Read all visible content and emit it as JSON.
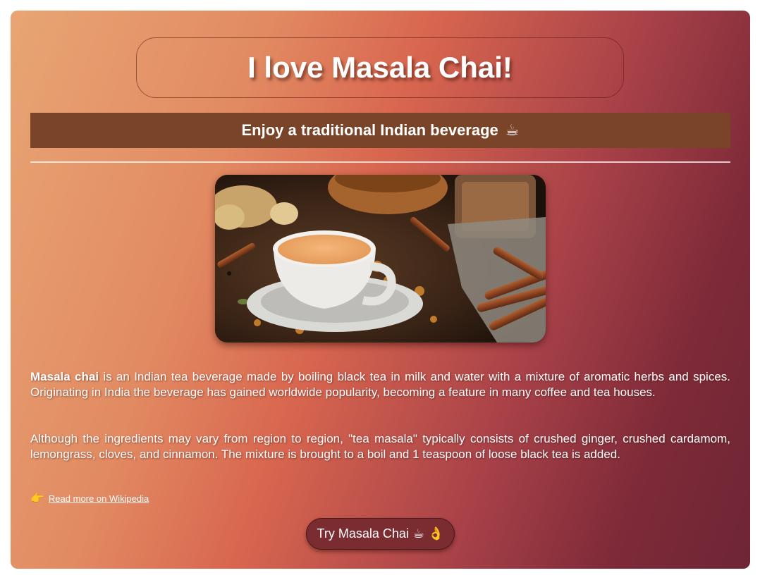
{
  "header": {
    "title": "I love Masala Chai!",
    "subtitle": "Enjoy a traditional Indian beverage",
    "subtitle_icon": "☕"
  },
  "content": {
    "p1_bold": "Masala chai",
    "p1_rest": " is an Indian tea beverage made by boiling black tea in milk and water with a mixture of aromatic herbs and spices. Originating in India the beverage has gained worldwide popularity, becoming a feature in many coffee and tea houses.",
    "p2": "Although the ingredients may vary from region to region, \"tea masala\" typically consists of crushed ginger, crushed cardamom, lemongrass, cloves, and cinnamon. The mixture is brought to a boil and 1 teaspoon of loose black tea is added."
  },
  "link": {
    "icon": "👉",
    "label": "Read more on Wikipedia"
  },
  "button": {
    "label": "Try Masala Chai",
    "icons": "☕ 👌"
  },
  "colors": {
    "subtitle_bar": "#7a4428",
    "button_bg": "#7a2c30"
  }
}
